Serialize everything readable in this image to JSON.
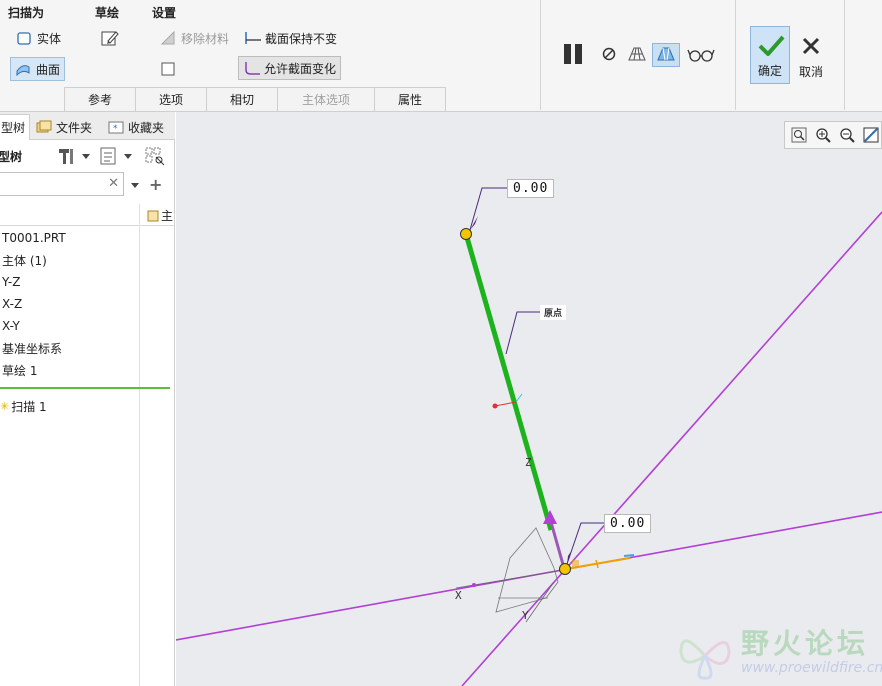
{
  "ribbon": {
    "groups": {
      "sweep_as": "扫描为",
      "sketch": "草绘",
      "settings": "设置"
    },
    "buttons": {
      "solid": "实体",
      "surface": "曲面",
      "remove_material": "移除材料",
      "constant_section": "截面保持不变",
      "variable_section": "允许截面变化"
    },
    "tabs": [
      "参考",
      "选项",
      "相切",
      "主体选项",
      "属性"
    ],
    "ok": "确定",
    "cancel": "取消"
  },
  "panel": {
    "tabs": [
      "型树",
      "文件夹",
      "收藏夹"
    ],
    "title": "型树",
    "search": {
      "value": "",
      "placeholder": ""
    },
    "column_header": "主",
    "items": [
      "T0001.PRT",
      "主体 (1)",
      "Y-Z",
      "X-Z",
      "X-Y",
      "基准坐标系",
      "草绘 1",
      "扫描 1"
    ]
  },
  "graphics": {
    "dims": [
      "0.00",
      "0.00"
    ],
    "origin_label": "原点",
    "axes": {
      "x": "X",
      "y": "Y",
      "z": "Z"
    }
  },
  "watermark": {
    "title": "野火论坛",
    "url": "www.proewildfire.cn"
  },
  "colors": {
    "trajectory": "#1db31d",
    "datum_plane": "#b23fd6",
    "highlight": "#f0a000",
    "ok_bg": "#cfe3f6",
    "check": "#2a9a2a"
  }
}
